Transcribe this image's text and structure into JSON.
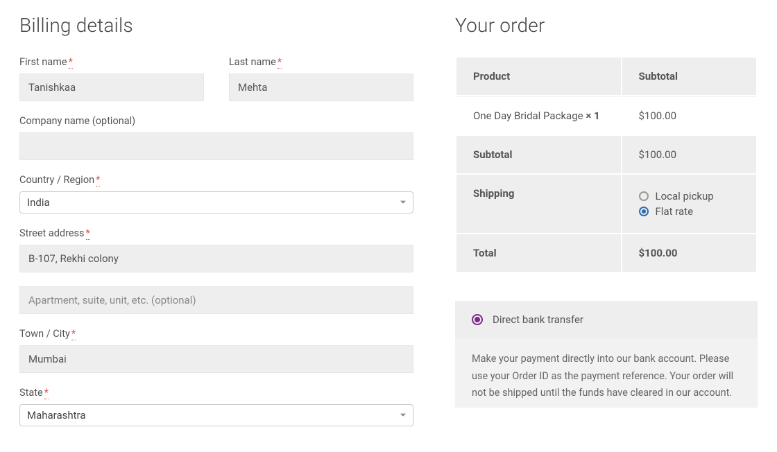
{
  "billing": {
    "heading": "Billing details",
    "first_name_label": "First name",
    "first_name_value": "Tanishkaa",
    "last_name_label": "Last name",
    "last_name_value": "Mehta",
    "company_label": "Company name (optional)",
    "company_value": "",
    "country_label": "Country / Region",
    "country_value": "India",
    "street_label": "Street address",
    "street_value": "B-107, Rekhi colony",
    "street2_placeholder": "Apartment, suite, unit, etc. (optional)",
    "street2_value": "",
    "city_label": "Town / City",
    "city_value": "Mumbai",
    "state_label": "State",
    "state_value": "Maharashtra",
    "required_mark": "*"
  },
  "order": {
    "heading": "Your order",
    "col_product": "Product",
    "col_subtotal": "Subtotal",
    "item_name": "One Day Bridal Package ",
    "item_qty": " × 1",
    "item_price": "$100.00",
    "subtotal_label": "Subtotal",
    "subtotal_value": "$100.00",
    "shipping_label": "Shipping",
    "shipping_options": {
      "local": "Local pickup",
      "flat": "Flat rate"
    },
    "total_label": "Total",
    "total_value": "$100.00"
  },
  "payment": {
    "method_label": "Direct bank transfer",
    "description": "Make your payment directly into our bank account. Please use your Order ID as the payment reference. Your order will not be shipped until the funds have cleared in our account."
  }
}
